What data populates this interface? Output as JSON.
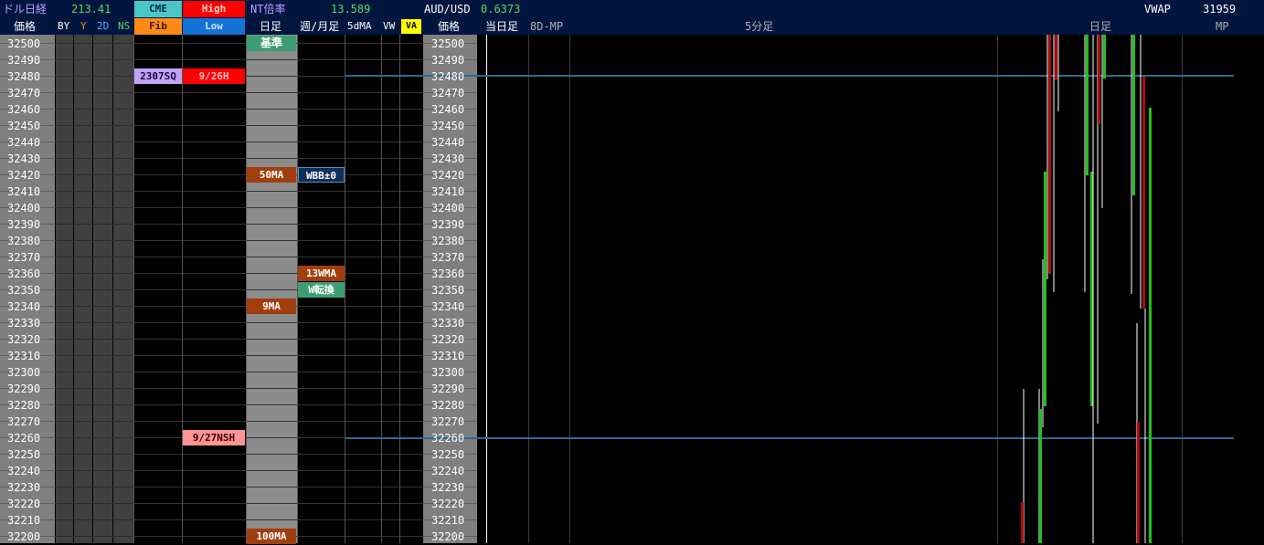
{
  "header": {
    "title": "ドル日経",
    "title_value": "213.41",
    "cme": "CME",
    "high": "High",
    "nt_label": "NT倍率",
    "nt_value": "13.589",
    "audusd_label": "AUD/USD",
    "audusd_value": "0.6373",
    "vwap_label": "VWAP",
    "vwap_value": "31959"
  },
  "columns": {
    "price": "価格",
    "by": "BY",
    "y": "Y",
    "two_d": "2D",
    "ns": "NS",
    "fib": "Fib",
    "low": "Low",
    "daily": "日足",
    "weekly_monthly": "週/月足",
    "five_dma": "5dMA",
    "vw": "VW",
    "va": "VA",
    "price2": "価格",
    "today": "当日足",
    "eight_d_mp": "8D-MP",
    "five_min": "5分足",
    "daily2": "日足",
    "mp": "MP"
  },
  "prices": [
    "32500",
    "32490",
    "32480",
    "32470",
    "32460",
    "32450",
    "32440",
    "32430",
    "32420",
    "32410",
    "32400",
    "32390",
    "32380",
    "32370",
    "32360",
    "32350",
    "32340",
    "32330",
    "32320",
    "32310",
    "32300",
    "32290",
    "32280",
    "32270",
    "32260",
    "32250",
    "32240",
    "32230",
    "32220",
    "32210",
    "32200"
  ],
  "markers": {
    "kijun": "基準",
    "sq": "2307SQ",
    "high_9_26": "9/26H",
    "ma50": "50MA",
    "wbb": "WBB±0",
    "w13ma": "13WMA",
    "wtenkan": "W転換",
    "ma9": "9MA",
    "nsh": "9/27NSH",
    "ma100": "100MA"
  },
  "colors": {
    "header_bg": "#00163f",
    "price_col_bg": "#7f7f7f",
    "daily_col_bg": "#8c8c8c",
    "cme_bg": "#4bc6c6",
    "high_bg": "#ff0000",
    "fib_bg": "#ff8a1a",
    "low_bg": "#1472d6",
    "marker_green": "#3e9e73",
    "marker_brown": "#a13e0e",
    "marker_purple": "#c3a3f5",
    "marker_pink": "#ff9494",
    "marker_blue": "#0e2f58",
    "va_bg": "#ffff00",
    "candle_green": "#22c01e",
    "candle_red": "#b00c0c",
    "hline": "#2b6b8f"
  }
}
